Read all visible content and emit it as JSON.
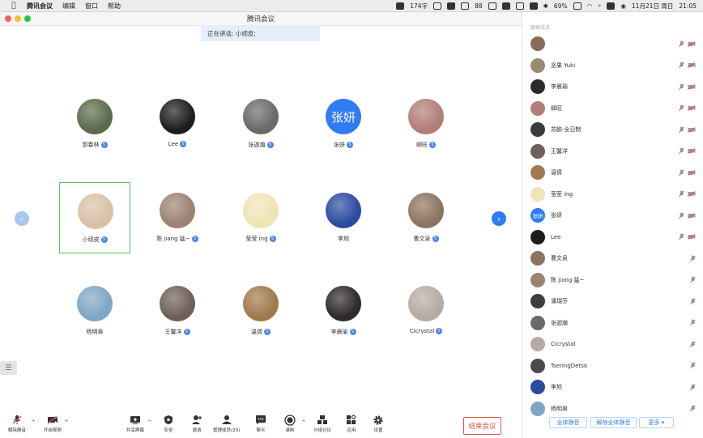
{
  "menubar": {
    "app": "腾讯会议",
    "menus": [
      "编辑",
      "窗口",
      "帮助"
    ],
    "word_count": "174字",
    "badge_88": "88",
    "battery": "69%",
    "datetime": "11月21日 周日",
    "time": "21:05"
  },
  "window": {
    "title": "腾讯会议"
  },
  "speaking": {
    "label": "正在讲话: 小顽皮;"
  },
  "grid": [
    {
      "name": "郭春林",
      "avatar_color": "#5b6b4a",
      "badge": "5"
    },
    {
      "name": "Lee",
      "avatar_color": "#1d1d1d",
      "badge": "5"
    },
    {
      "name": "张迦瀚",
      "avatar_color": "#6a6a6a",
      "badge": "5"
    },
    {
      "name": "张妍",
      "avatar_text": "张妍",
      "badge": "5"
    },
    {
      "name": "卿旺",
      "avatar_color": "#b27d78",
      "badge": "5"
    },
    {
      "name": "小顽皮",
      "avatar_color": "#d9c1a6",
      "badge": "5",
      "active": true
    },
    {
      "name": "陈 jiang 猛~",
      "avatar_color": "#9b8373",
      "badge": "5"
    },
    {
      "name": "莹莹 ing",
      "avatar_color": "#f0e4b4",
      "badge": "5"
    },
    {
      "name": "李旭",
      "avatar_color": "#2c4ba0",
      "badge": ""
    },
    {
      "name": "曹文泉",
      "avatar_color": "#8c7460",
      "badge": "5"
    },
    {
      "name": "杨明昊",
      "avatar_color": "#7fa6c5",
      "badge": ""
    },
    {
      "name": "王馨洋",
      "avatar_color": "#6e5f58",
      "badge": "5"
    },
    {
      "name": "温倩",
      "avatar_color": "#a07a4c",
      "badge": "5"
    },
    {
      "name": "李晨瑜",
      "avatar_color": "#2f2a2a",
      "badge": "5"
    },
    {
      "name": "Cicrystal",
      "avatar_color": "#b7aaa3",
      "badge": "5"
    }
  ],
  "toolbar": {
    "unmute": "解除静音",
    "video": "开启视频",
    "share": "共享屏幕",
    "security": "安全",
    "invite": "邀请",
    "manage": "管理成员(20)",
    "chat": "聊天",
    "record": "录制",
    "breakout": "分组讨论",
    "apps": "应用",
    "settings": "设置",
    "end": "结束会议"
  },
  "panel": {
    "search_placeholder": "搜索成员",
    "members": [
      {
        "name": "",
        "avatar_color": "#8a6b5a",
        "cam": true
      },
      {
        "name": "坚果 Yuki",
        "avatar_color": "#9c8a72",
        "cam": true
      },
      {
        "name": "李晨瑜",
        "avatar_color": "#2f2a2a",
        "cam": true
      },
      {
        "name": "卿旺",
        "avatar_color": "#b27d78",
        "cam": true
      },
      {
        "name": "苏鹏-全日制",
        "avatar_color": "#3b3b3b",
        "cam": true
      },
      {
        "name": "王馨洋",
        "avatar_color": "#6e5f58",
        "cam": true
      },
      {
        "name": "温倩",
        "avatar_color": "#a07a4c",
        "cam": true
      },
      {
        "name": "莹莹 ing",
        "avatar_color": "#f0e4b4",
        "cam": true
      },
      {
        "name": "张妍",
        "avatar_text": "张妍",
        "cam": true
      },
      {
        "name": "Lee",
        "avatar_color": "#1d1d1d",
        "cam": true
      },
      {
        "name": "曹文泉",
        "avatar_color": "#8c7460",
        "cam": false
      },
      {
        "name": "陈 jiang 猛~",
        "avatar_color": "#9b8373",
        "cam": false
      },
      {
        "name": "潘瑞芬",
        "avatar_color": "#3d3d3d",
        "cam": false
      },
      {
        "name": "张迦瀚",
        "avatar_color": "#6a6a6a",
        "cam": false
      },
      {
        "name": "Cicrystal",
        "avatar_color": "#b7aaa3",
        "cam": false
      },
      {
        "name": "TseringDetso",
        "avatar_color": "#4b4b4b",
        "cam": false
      },
      {
        "name": "李旭",
        "avatar_color": "#2c4ba0",
        "cam": false
      },
      {
        "name": "杨明昊",
        "avatar_color": "#7fa6c5",
        "cam": false
      }
    ],
    "mute_all": "全体静音",
    "unmute_all": "解除全体静音",
    "more": "更多 ▾"
  },
  "colors": {
    "accent": "#2f7cf6",
    "active_border": "#57c45d",
    "end_red": "#e34d4d"
  }
}
